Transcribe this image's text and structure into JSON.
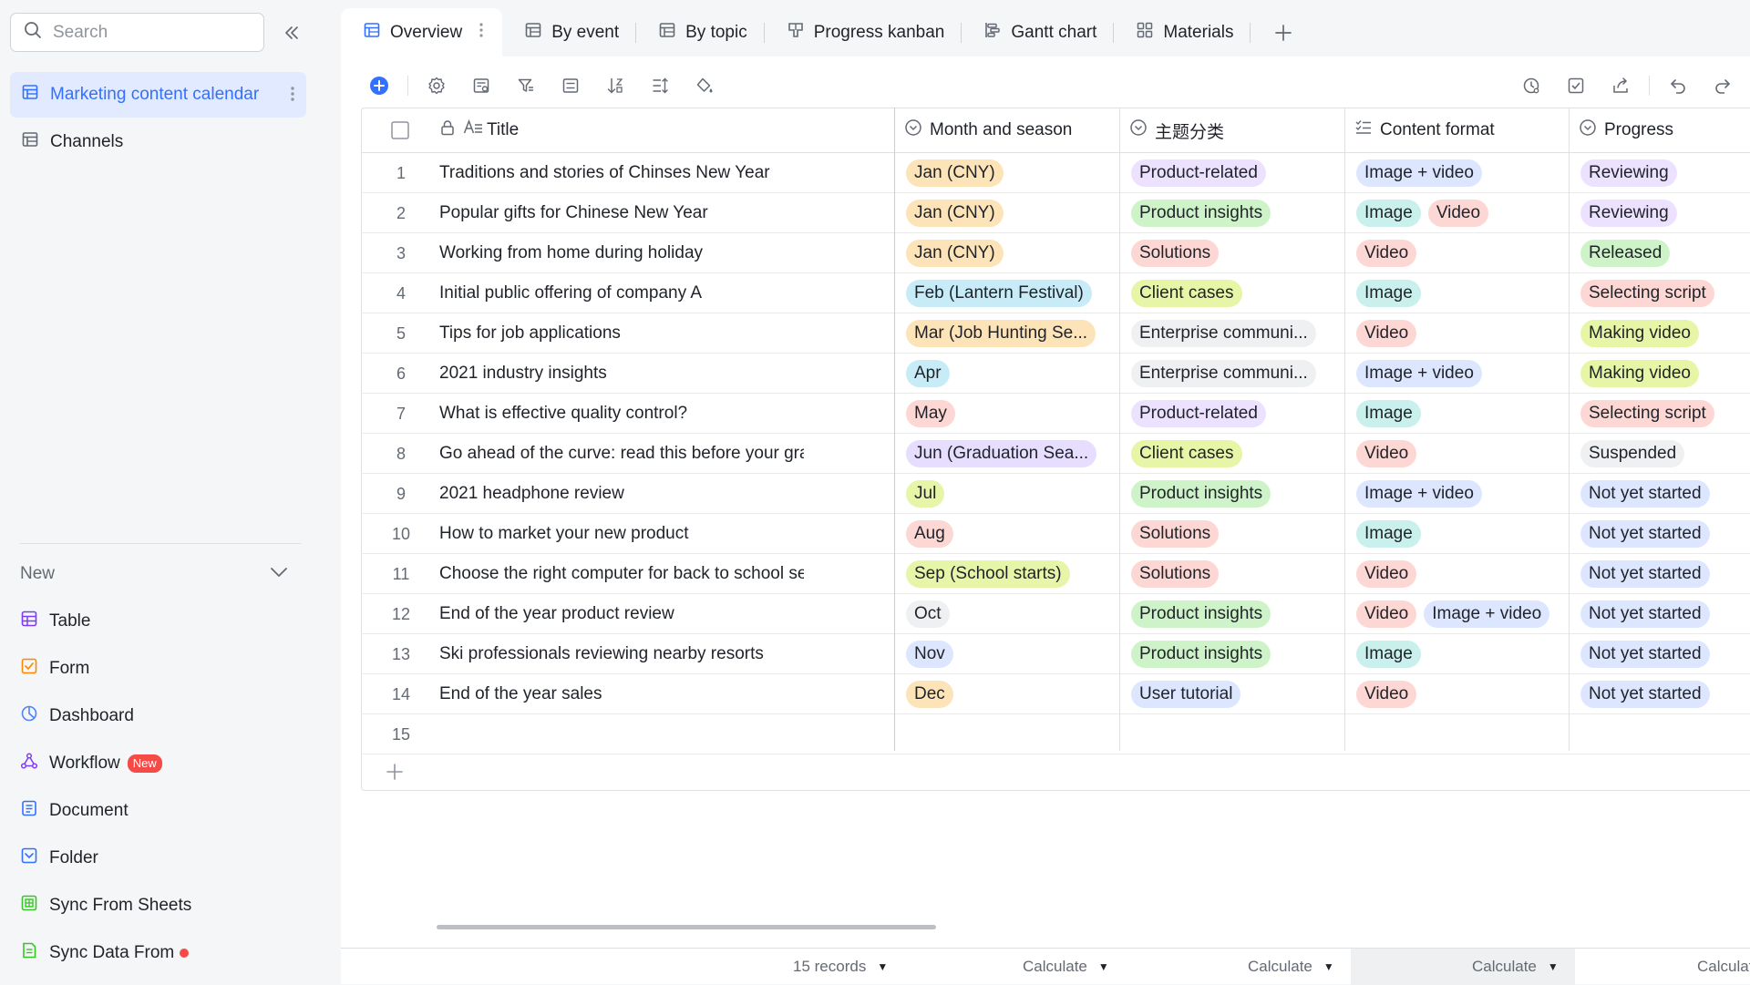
{
  "sidebar": {
    "search_placeholder": "Search",
    "tables": [
      {
        "label": "Marketing content calendar",
        "active": true
      },
      {
        "label": "Channels",
        "active": false
      }
    ],
    "new_section": {
      "label": "New",
      "items": [
        {
          "label": "Table",
          "icon": "table-icon",
          "color": "#7f3bf5"
        },
        {
          "label": "Form",
          "icon": "form-icon",
          "color": "#ff8800"
        },
        {
          "label": "Dashboard",
          "icon": "dashboard-icon",
          "color": "#4e83fd"
        },
        {
          "label": "Workflow",
          "icon": "workflow-icon",
          "color": "#7f3bf5",
          "badge": "New"
        },
        {
          "label": "Document",
          "icon": "document-icon",
          "color": "#3370ff"
        },
        {
          "label": "Folder",
          "icon": "folder-icon",
          "color": "#3370ff"
        },
        {
          "label": "Sync From Sheets",
          "icon": "sheets-icon",
          "color": "#34c724"
        },
        {
          "label": "Sync Data From",
          "icon": "sync-data-icon",
          "color": "#34c724",
          "dot": true
        }
      ]
    }
  },
  "tabs": [
    {
      "label": "Overview",
      "icon": "grid-view-icon",
      "active": true
    },
    {
      "label": "By event",
      "icon": "grid-view-icon"
    },
    {
      "label": "By topic",
      "icon": "grid-view-icon"
    },
    {
      "label": "Progress kanban",
      "icon": "kanban-icon"
    },
    {
      "label": "Gantt chart",
      "icon": "gantt-icon"
    },
    {
      "label": "Materials",
      "icon": "gallery-icon"
    }
  ],
  "columns": [
    {
      "label": "Title",
      "icon": "text-field-icon"
    },
    {
      "label": "Month and season",
      "icon": "single-select-icon"
    },
    {
      "label": "主题分类",
      "icon": "single-select-icon"
    },
    {
      "label": "Content format",
      "icon": "multi-select-icon"
    },
    {
      "label": "Progress",
      "icon": "single-select-icon"
    }
  ],
  "rows": [
    {
      "n": "1",
      "title": "Traditions and stories of Chinses New Year",
      "month": "Jan (CNY)",
      "topic": "Product-related",
      "format": [
        "Image + video"
      ],
      "progress": "Reviewing"
    },
    {
      "n": "2",
      "title": "Popular gifts for Chinese New Year",
      "month": "Jan (CNY)",
      "topic": "Product insights",
      "format": [
        "Image",
        "Video"
      ],
      "progress": "Reviewing"
    },
    {
      "n": "3",
      "title": "Working from home during holiday",
      "month": "Jan (CNY)",
      "topic": "Solutions",
      "format": [
        "Video"
      ],
      "progress": "Released"
    },
    {
      "n": "4",
      "title": "Initial public offering of company A",
      "month": "Feb (Lantern Festival)",
      "topic": "Client cases",
      "format": [
        "Image"
      ],
      "progress": "Selecting script"
    },
    {
      "n": "5",
      "title": "Tips for job applications",
      "month": "Mar (Job Hunting Se...",
      "topic": "Enterprise communi...",
      "format": [
        "Video"
      ],
      "progress": "Making video"
    },
    {
      "n": "6",
      "title": "2021 industry insights",
      "month": "Apr",
      "topic": "Enterprise communi...",
      "format": [
        "Image + video"
      ],
      "progress": "Making video"
    },
    {
      "n": "7",
      "title": "What is effective quality control?",
      "month": "May",
      "topic": "Product-related",
      "format": [
        "Image"
      ],
      "progress": "Selecting script"
    },
    {
      "n": "8",
      "title": "Go ahead of the curve: read this before your graduation",
      "month": "Jun (Graduation Sea...",
      "topic": "Client cases",
      "format": [
        "Video"
      ],
      "progress": "Suspended"
    },
    {
      "n": "9",
      "title": "2021 headphone review",
      "month": "Jul",
      "topic": "Product insights",
      "format": [
        "Image + video"
      ],
      "progress": "Not yet started"
    },
    {
      "n": "10",
      "title": "How to market your new product",
      "month": "Aug",
      "topic": "Solutions",
      "format": [
        "Image"
      ],
      "progress": "Not yet started"
    },
    {
      "n": "11",
      "title": "Choose the right computer for back to school season",
      "month": "Sep (School starts)",
      "topic": "Solutions",
      "format": [
        "Video"
      ],
      "progress": "Not yet started"
    },
    {
      "n": "12",
      "title": "End of the year product review",
      "month": "Oct",
      "topic": "Product insights",
      "format": [
        "Video",
        "Image + video"
      ],
      "progress": "Not yet started"
    },
    {
      "n": "13",
      "title": "Ski professionals reviewing nearby resorts",
      "month": "Nov",
      "topic": "Product insights",
      "format": [
        "Image"
      ],
      "progress": "Not yet started"
    },
    {
      "n": "14",
      "title": "End of the year sales",
      "month": "Dec",
      "topic": "User tutorial",
      "format": [
        "Video"
      ],
      "progress": "Not yet started"
    },
    {
      "n": "15",
      "title": "",
      "month": "",
      "topic": "",
      "format": [],
      "progress": ""
    }
  ],
  "tag_colors": {
    "Jan (CNY)": "#fde3b8",
    "Feb (Lantern Festival)": "#c7ecf7",
    "Mar (Job Hunting Se...": "#fde3b8",
    "Apr": "#c7ecf7",
    "May": "#fdd7d3",
    "Jun (Graduation Sea...": "#e7deff",
    "Jul": "#e7f5a8",
    "Aug": "#fdd7d3",
    "Sep (School starts)": "#e7f5a8",
    "Oct": "#eff0f1",
    "Nov": "#dde6ff",
    "Dec": "#fde3b8",
    "Product-related": "#ece2ff",
    "Product insights": "#cff3c8",
    "Solutions": "#fdd7d3",
    "Client cases": "#e6f5a6",
    "Enterprise communi...": "#eff0f1",
    "User tutorial": "#dde6ff",
    "Image + video": "#dde6ff",
    "Image": "#c9f0ec",
    "Video": "#fdd7d3",
    "Reviewing": "#ece2ff",
    "Released": "#cff3c8",
    "Selecting script": "#fdd7d3",
    "Making video": "#e6f5a6",
    "Suspended": "#eff0f1",
    "Not yet started": "#dde6ff"
  },
  "footer": {
    "records": "15 records",
    "calculate": "Calculate"
  }
}
